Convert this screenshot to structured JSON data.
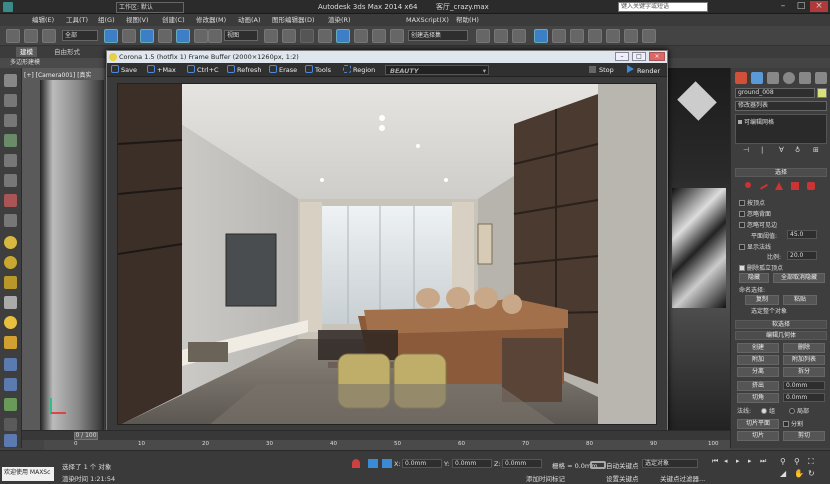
{
  "titlebar": {
    "workspace_label": "工作区: 默认",
    "app_title": "Autodesk 3ds Max  2014 x64",
    "file_name": "客厅_crazy.max",
    "search_placeholder": "键入关键字或短语"
  },
  "menubar": {
    "items": [
      "编辑(E)",
      "工具(T)",
      "组(G)",
      "视图(V)",
      "创建(C)",
      "修改器(M)",
      "动画(A)",
      "图形编辑器(D)",
      "渲染(R)",
      "MAXScript(X)",
      "帮助(H)"
    ]
  },
  "toolbar": {
    "selection_filter": "全部",
    "ref_coord": "视图",
    "named_selection": "创建选择集"
  },
  "ribbon": {
    "tabs": [
      "建模",
      "自由形式"
    ],
    "subtitle": "多边形建模"
  },
  "viewport": {
    "label": "[+] [Camera001] [真实"
  },
  "frame_buffer": {
    "title": "Corona 1.5 (hotfix 1) Frame Buffer (2000×1260px, 1:2)",
    "buttons": {
      "save": "Save",
      "max": "+Max",
      "ctrlc": "Ctrl+C",
      "refresh": "Refresh",
      "erase": "Erase",
      "tools": "Tools",
      "region": "Region",
      "stop": "Stop",
      "render": "Render"
    },
    "channel": "BEAUTY"
  },
  "command_panel": {
    "object_name": "ground_008",
    "modifier_list": "修改器列表",
    "stack_item": "可编辑网格",
    "selection_title": "选择",
    "by_vertex": "按顶点",
    "ignore_backfacing": "忽略背面",
    "ignore_visible_edges": "忽略可见边",
    "planar_threshold_label": "平面阈值:",
    "planar_threshold_value": "45.0",
    "show_normals": "显示法线",
    "scale_label": "比例:",
    "scale_value": "20.0",
    "delete_isolated": "删除孤立顶点",
    "hide": "隐藏",
    "unhide_all": "全部取消隐藏",
    "named_selections": "命名选择:",
    "copy": "复制",
    "paste": "粘贴",
    "select_whole": "选定整个对象",
    "soft_selection": "软选择",
    "edit_geometry": "编辑几何体",
    "create": "创建",
    "delete": "删除",
    "attach": "附加",
    "attach_list": "附加列表",
    "detach": "分离",
    "break": "拆分",
    "extrude": "挤出",
    "extrude_value": "0.0mm",
    "chamfer": "切角",
    "chamfer_value": "0.0mm",
    "normal_label": "法线:",
    "group": "组",
    "local": "局部",
    "slice_plane": "切片平面",
    "slice": "切片",
    "cut": "剪切",
    "split": "分割"
  },
  "timeline": {
    "frame_counter": "0 / 100",
    "ticks": [
      "0",
      "10",
      "20",
      "30",
      "40",
      "50",
      "60",
      "70",
      "80",
      "90",
      "100"
    ]
  },
  "statusbar": {
    "welcome": "欢迎使用 MAXSc",
    "selected": "选择了 1 个 对象",
    "render_time_label": "渲染时间",
    "render_time": "1:21:54",
    "x_value": "0.0mm",
    "y_value": "0.0mm",
    "z_value": "0.0mm",
    "grid": "栅格 = 0.0mm",
    "auto_key": "自动关键点",
    "selected_obj": "选定对象",
    "set_key": "设置关键点",
    "key_filters": "关键点过滤器...",
    "add_time_tag": "添加时间标记"
  },
  "colors": {
    "accent": "#3d7fc7",
    "swatch": "#d8e07a"
  }
}
